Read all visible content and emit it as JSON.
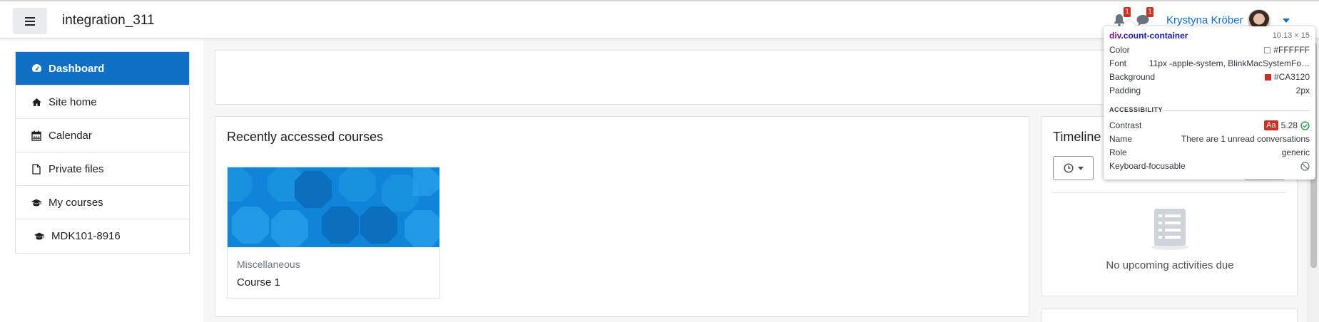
{
  "header": {
    "site_title": "integration_311",
    "notification_count": "1",
    "message_count": "1",
    "user_name": "Krystyna Kröber"
  },
  "nav": {
    "items": [
      {
        "label": "Dashboard",
        "icon": "dashboard-icon",
        "active": true
      },
      {
        "label": "Site home",
        "icon": "home-icon"
      },
      {
        "label": "Calendar",
        "icon": "calendar-icon"
      },
      {
        "label": "Private files",
        "icon": "file-icon"
      },
      {
        "label": "My courses",
        "icon": "graduation-cap-icon"
      },
      {
        "label": "MDK101-8916",
        "icon": "graduation-cap-icon"
      }
    ]
  },
  "recent": {
    "title": "Recently accessed courses",
    "course": {
      "category": "Miscellaneous",
      "name": "Course 1"
    }
  },
  "timeline": {
    "title": "Timeline",
    "empty_text": "No upcoming activities due"
  },
  "devtools_tooltip": {
    "selector_tag": "div",
    "selector_class": ".count-container",
    "size": "10.13 × 15",
    "rows": [
      {
        "label": "Color",
        "value": "#FFFFFF",
        "swatch": "#FFFFFF"
      },
      {
        "label": "Font",
        "value": "11px -apple-system, BlinkMacSystemFo…"
      },
      {
        "label": "Background",
        "value": "#CA3120",
        "swatch": "#CA3120"
      },
      {
        "label": "Padding",
        "value": "2px"
      }
    ],
    "section": "ACCESSIBILITY",
    "acc_rows": [
      {
        "label": "Contrast",
        "value": "5.28",
        "badge": "Aa"
      },
      {
        "label": "Name",
        "value": "There are 1 unread conversations"
      },
      {
        "label": "Role",
        "value": "generic"
      },
      {
        "label": "Keyboard-focusable",
        "value": ""
      }
    ]
  },
  "colors": {
    "brand": "#0f6fc5",
    "badge": "#CA3120"
  }
}
